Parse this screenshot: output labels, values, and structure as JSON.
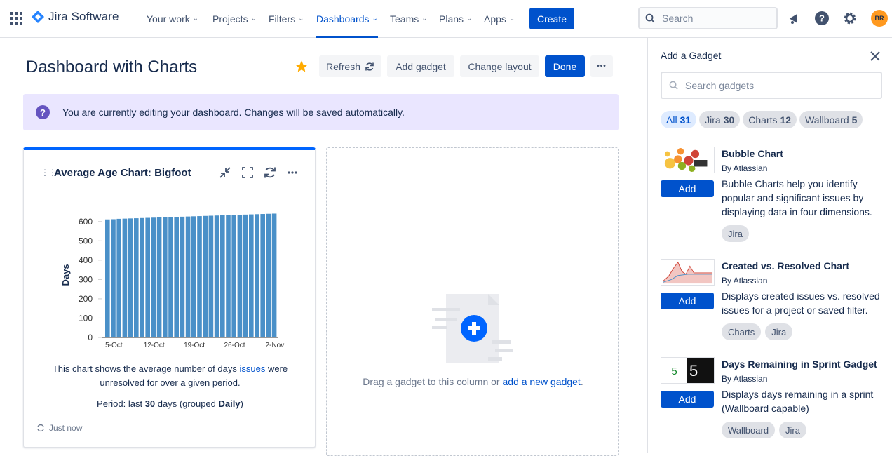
{
  "nav": {
    "product_name": "Jira Software",
    "items": [
      "Your work",
      "Projects",
      "Filters",
      "Dashboards",
      "Teams",
      "Plans",
      "Apps"
    ],
    "active_item": "Dashboards",
    "create_label": "Create",
    "search_placeholder": "Search",
    "avatar_initials": "BR",
    "icons": [
      "apps-grid-icon",
      "jira-logo-icon",
      "notifications-icon",
      "help-icon",
      "settings-icon"
    ]
  },
  "header": {
    "title": "Dashboard with Charts",
    "refresh_label": "Refresh",
    "add_gadget_label": "Add gadget",
    "change_layout_label": "Change layout",
    "done_label": "Done",
    "more_label": "•••"
  },
  "banner": {
    "text": "You are currently editing your dashboard. Changes will be saved automatically."
  },
  "gadget": {
    "title": "Average Age Chart: Bigfoot",
    "desc_before": "This chart shows the average number of days ",
    "desc_link": "issues",
    "desc_after": " were unresolved for over a given period.",
    "period_prefix": "Period: last ",
    "period_days": "30",
    "period_mid": " days (grouped ",
    "period_group": "Daily",
    "period_suffix": ")",
    "refreshed": "Just now"
  },
  "chart_data": {
    "type": "bar",
    "ylabel": "Days",
    "xlabel": "",
    "ylim": [
      0,
      650
    ],
    "yticks": [
      0,
      100,
      200,
      300,
      400,
      500,
      600
    ],
    "xtick_labels": [
      "5-Oct",
      "12-Oct",
      "19-Oct",
      "26-Oct",
      "2-Nov"
    ],
    "values": [
      611,
      612,
      614,
      615,
      616,
      617,
      618,
      619,
      620,
      621,
      622,
      623,
      624,
      625,
      626,
      627,
      628,
      629,
      630,
      631,
      632,
      633,
      634,
      635,
      636,
      637,
      638,
      639,
      640,
      641
    ],
    "color": "#4a90c8",
    "grid": false
  },
  "dropzone": {
    "text_before": "Drag a gadget to this column or ",
    "link": "add a new gadget",
    "text_after": "."
  },
  "panel": {
    "title": "Add a Gadget",
    "search_placeholder": "Search gadgets",
    "filters": [
      {
        "label": "All",
        "count": "31"
      },
      {
        "label": "Jira",
        "count": "30"
      },
      {
        "label": "Charts",
        "count": "12"
      },
      {
        "label": "Wallboard",
        "count": "5"
      }
    ],
    "add_label": "Add",
    "gadgets": [
      {
        "name": "Bubble Chart",
        "by": "By Atlassian",
        "desc": "Bubble Charts help you identify popular and significant issues by displaying data in four dimensions.",
        "tags": [
          "Jira"
        ]
      },
      {
        "name": "Created vs. Resolved Chart",
        "by": "By Atlassian",
        "desc": "Displays created issues vs. resolved issues for a project or saved filter.",
        "tags": [
          "Charts",
          "Jira"
        ]
      },
      {
        "name": "Days Remaining in Sprint Gadget",
        "by": "By Atlassian",
        "desc": "Displays days remaining in a sprint (Wallboard capable)",
        "tags": [
          "Wallboard",
          "Jira"
        ],
        "thumb_digit": "5"
      }
    ]
  }
}
